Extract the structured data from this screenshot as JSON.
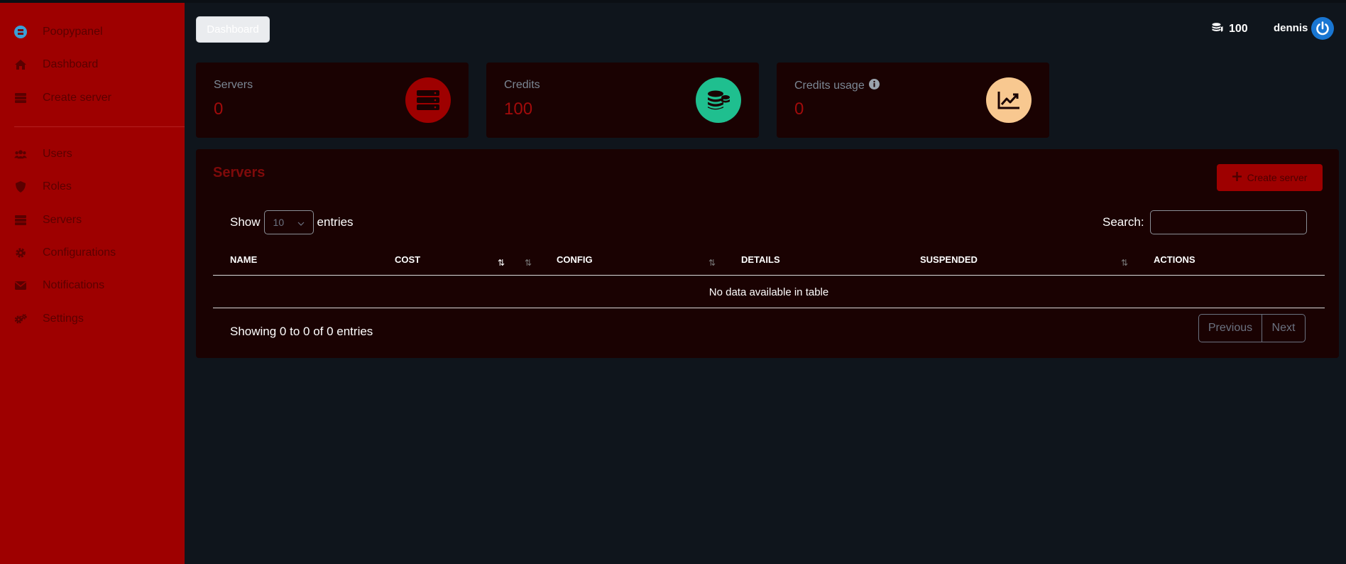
{
  "sidebar": {
    "brand": "Poopypanel",
    "items": [
      {
        "label": "Dashboard",
        "icon": "home-icon"
      },
      {
        "label": "Create server",
        "icon": "server-icon"
      },
      {
        "label": "Users",
        "icon": "users-icon"
      },
      {
        "label": "Roles",
        "icon": "shield-icon"
      },
      {
        "label": "Servers",
        "icon": "server-icon"
      },
      {
        "label": "Configurations",
        "icon": "gear-icon"
      },
      {
        "label": "Notifications",
        "icon": "envelope-icon"
      },
      {
        "label": "Settings",
        "icon": "gears-icon"
      }
    ]
  },
  "header": {
    "breadcrumb_button": "Dashboard",
    "credits": "100",
    "username": "dennis"
  },
  "cards": [
    {
      "title": "Servers",
      "value": "0",
      "icon": "server-icon",
      "color": "#9e0000"
    },
    {
      "title": "Credits",
      "value": "100",
      "icon": "coins-icon",
      "color": "#1fbf8f"
    },
    {
      "title": "Credits usage",
      "value": "0",
      "icon": "chart-line-icon",
      "color": "#f8c890"
    }
  ],
  "servers_table": {
    "title": "Servers",
    "create_button": "Create server",
    "show_label": "Show",
    "entries_label": "entries",
    "page_length": "10",
    "search_label": "Search:",
    "search_value": "",
    "columns": [
      "NAME",
      "COST",
      "CONFIG",
      "DETAILS",
      "SUSPENDED",
      "ACTIONS"
    ],
    "empty_message": "No data available in table",
    "info": "Showing 0 to 0 of 0 entries",
    "previous": "Previous",
    "next": "Next"
  },
  "colors": {
    "sidebar": "#9e0000",
    "background": "#0f151c",
    "card": "#1a0202",
    "accent_text": "#a10b0b"
  }
}
